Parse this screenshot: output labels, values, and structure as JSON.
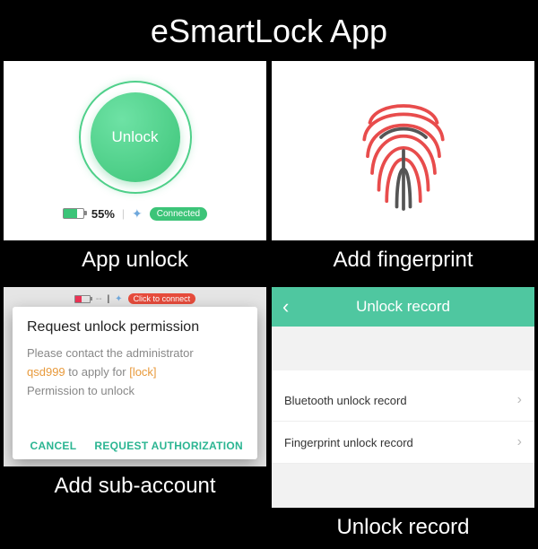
{
  "title": "eSmartLock App",
  "card1": {
    "unlock_label": "Unlock",
    "battery_pct": "55%",
    "connected_label": "Connected",
    "caption": "App unlock"
  },
  "card2": {
    "caption": "Add fingerprint"
  },
  "card3": {
    "strip_connect": "Click to connect",
    "dialog_title": "Request unlock permission",
    "body_line1": "Please contact the administrator",
    "admin": "qsd999",
    "body_mid": " to apply for ",
    "lock_label": "[lock]",
    "body_line3": "Permission to unlock",
    "cancel": "CANCEL",
    "request": "REQUEST AUTHORIZATION",
    "caption": "Add sub-account"
  },
  "card4": {
    "header": "Unlock record",
    "row1": "Bluetooth unlock record",
    "row2": "Fingerprint unlock record",
    "caption": "Unlock record"
  }
}
